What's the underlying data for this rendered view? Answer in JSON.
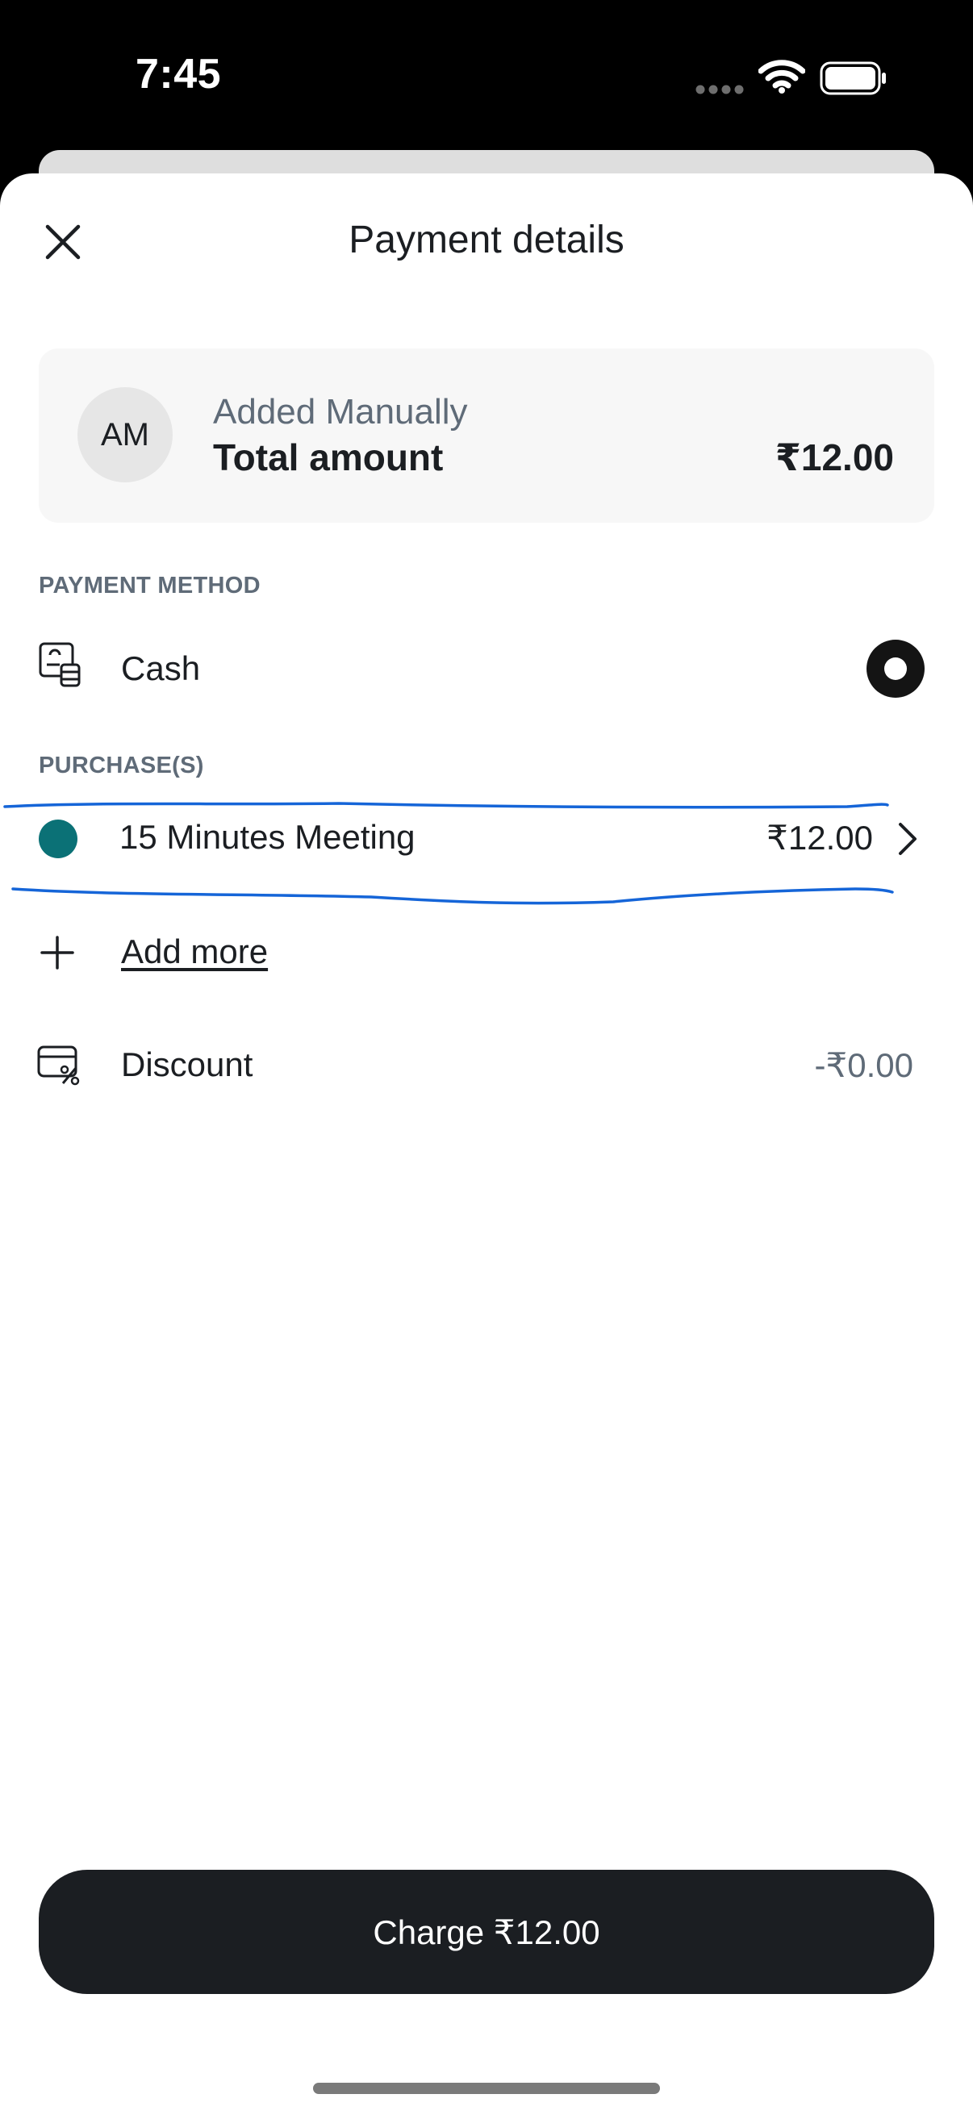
{
  "status_bar": {
    "time": "7:45",
    "icons": [
      "cellular-signal-icon",
      "wifi-icon",
      "battery-icon"
    ]
  },
  "header": {
    "title": "Payment details",
    "close_icon": "close-icon"
  },
  "customer": {
    "initials": "AM",
    "name": "Added Manually",
    "total_label": "Total amount",
    "total_value": "₹12.00"
  },
  "payment_method": {
    "section_label": "PAYMENT METHOD",
    "icon": "cash-icon",
    "label": "Cash",
    "selected": true
  },
  "purchases": {
    "section_label": "PURCHASE(S)",
    "items": [
      {
        "name": "15 Minutes Meeting",
        "price": "₹12.00",
        "color": "#0b7176"
      }
    ],
    "add_more_label": "Add more"
  },
  "discount": {
    "icon": "discount-icon",
    "label": "Discount",
    "value": "-₹0.00"
  },
  "charge_button": {
    "label": "Charge ₹12.00"
  },
  "colors": {
    "primary_dark": "#1b1e22",
    "secondary_text": "#5f6b78",
    "annotation_blue": "#1565d8",
    "card_background": "#f7f7f7"
  }
}
